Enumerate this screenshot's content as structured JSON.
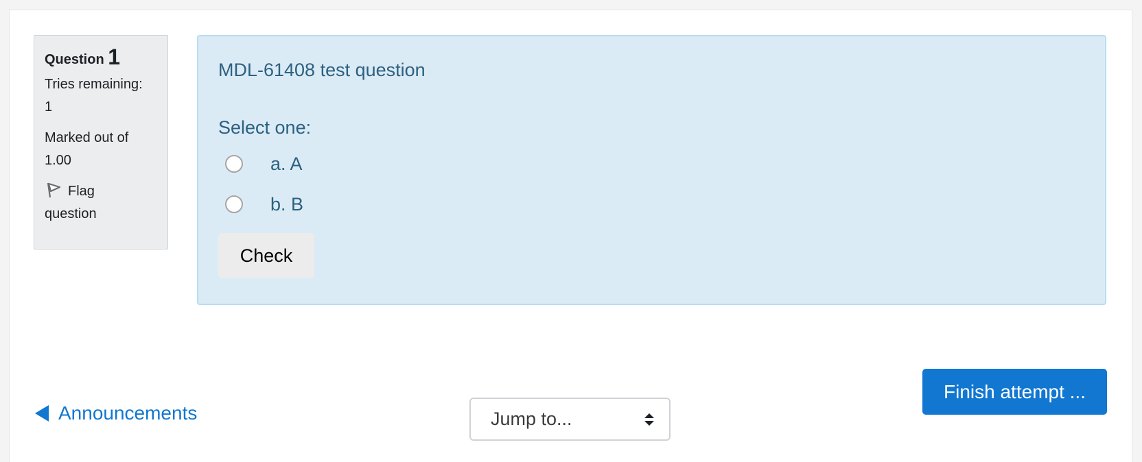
{
  "question_info": {
    "question_word": "Question",
    "question_number": "1",
    "tries_line1": "Tries remaining:",
    "tries_line2": "1",
    "marked_line1": "Marked out of",
    "marked_line2": "1.00",
    "flag_line1": "Flag",
    "flag_line2": "question"
  },
  "question": {
    "text": "MDL-61408 test question",
    "prompt": "Select one:",
    "options": [
      {
        "label": "a. A",
        "selected": false
      },
      {
        "label": "b. B",
        "selected": false
      }
    ],
    "check_label": "Check"
  },
  "navigation": {
    "prev_link": "Announcements",
    "jump_placeholder": "Jump to...",
    "finish_label": "Finish attempt ..."
  },
  "colors": {
    "accent": "#1177d1",
    "content_bg": "#dbebf5",
    "content_text": "#2c6181"
  }
}
